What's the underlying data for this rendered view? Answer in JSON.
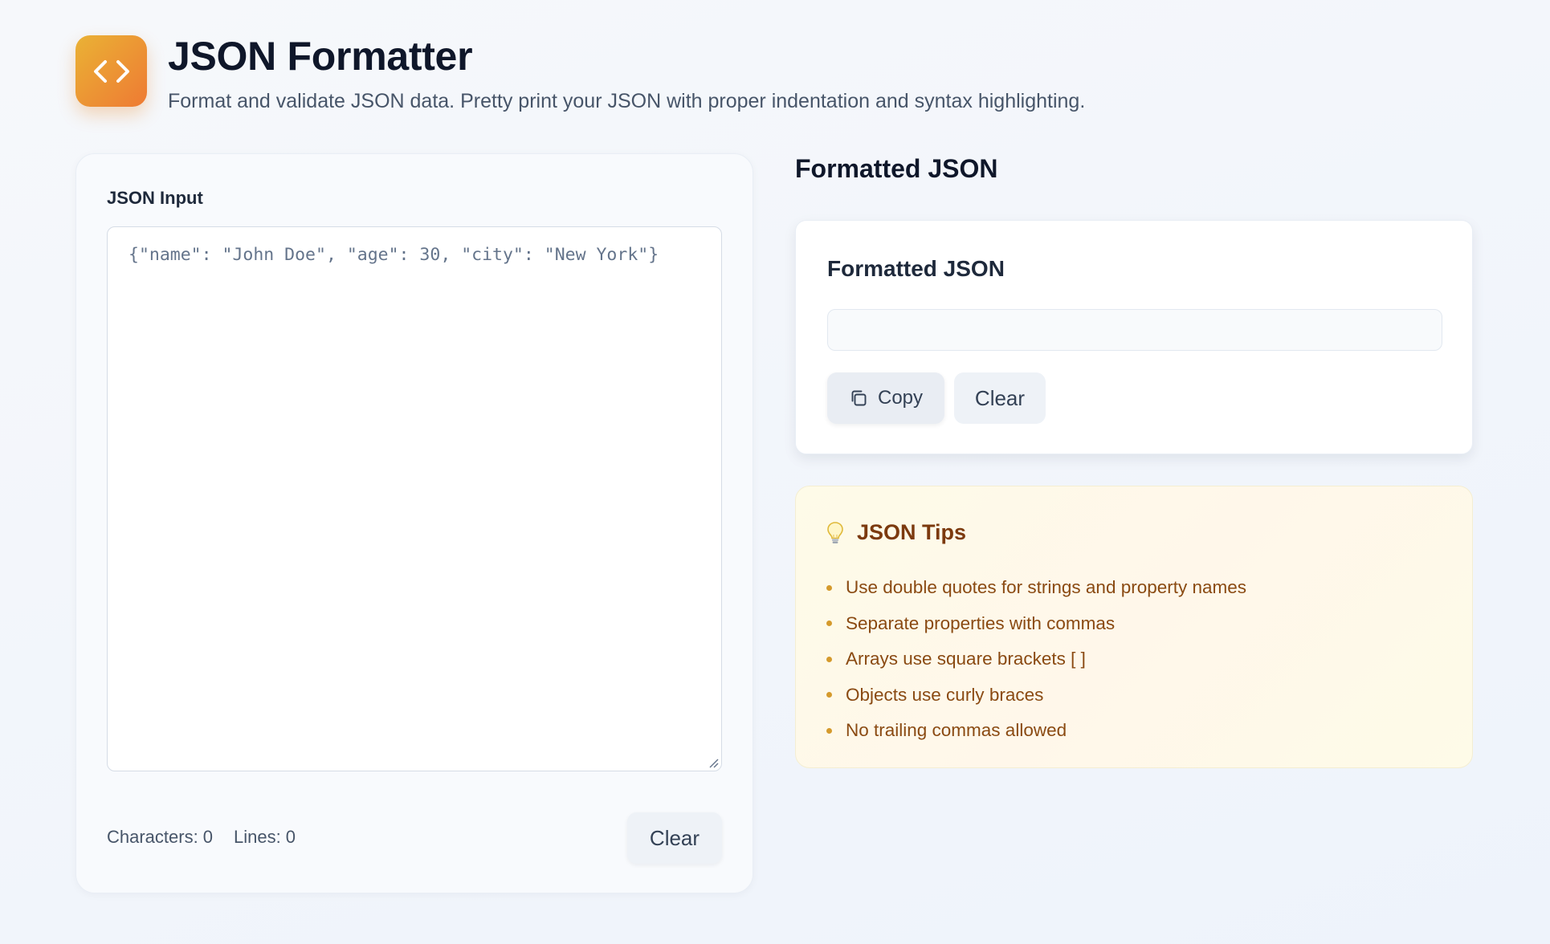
{
  "header": {
    "title": "JSON Formatter",
    "subtitle": "Format and validate JSON data. Pretty print your JSON with proper indentation and syntax highlighting.",
    "logo_icon": "code-brackets-icon"
  },
  "input_panel": {
    "label": "JSON Input",
    "placeholder": "{\"name\": \"John Doe\", \"age\": 30, \"city\": \"New York\"}",
    "value": "",
    "characters_label": "Characters:",
    "characters_value": "0",
    "lines_label": "Lines:",
    "lines_value": "0",
    "clear_label": "Clear"
  },
  "output_panel": {
    "heading": "Formatted JSON",
    "card_title": "Formatted JSON",
    "value": "",
    "copy_label": "Copy",
    "copy_icon": "copy-icon",
    "clear_label": "Clear"
  },
  "tips": {
    "icon": "lightbulb-icon",
    "title": "JSON Tips",
    "items": [
      "Use double quotes for strings and property names",
      "Separate properties with commas",
      "Arrays use square brackets [ ]",
      "Objects use curly braces",
      "No trailing commas allowed"
    ]
  },
  "colors": {
    "accent_gradient_start": "#eab235",
    "accent_gradient_end": "#ee7a33",
    "tips_text": "#8a4a12",
    "tips_title": "#7c3a0e"
  }
}
